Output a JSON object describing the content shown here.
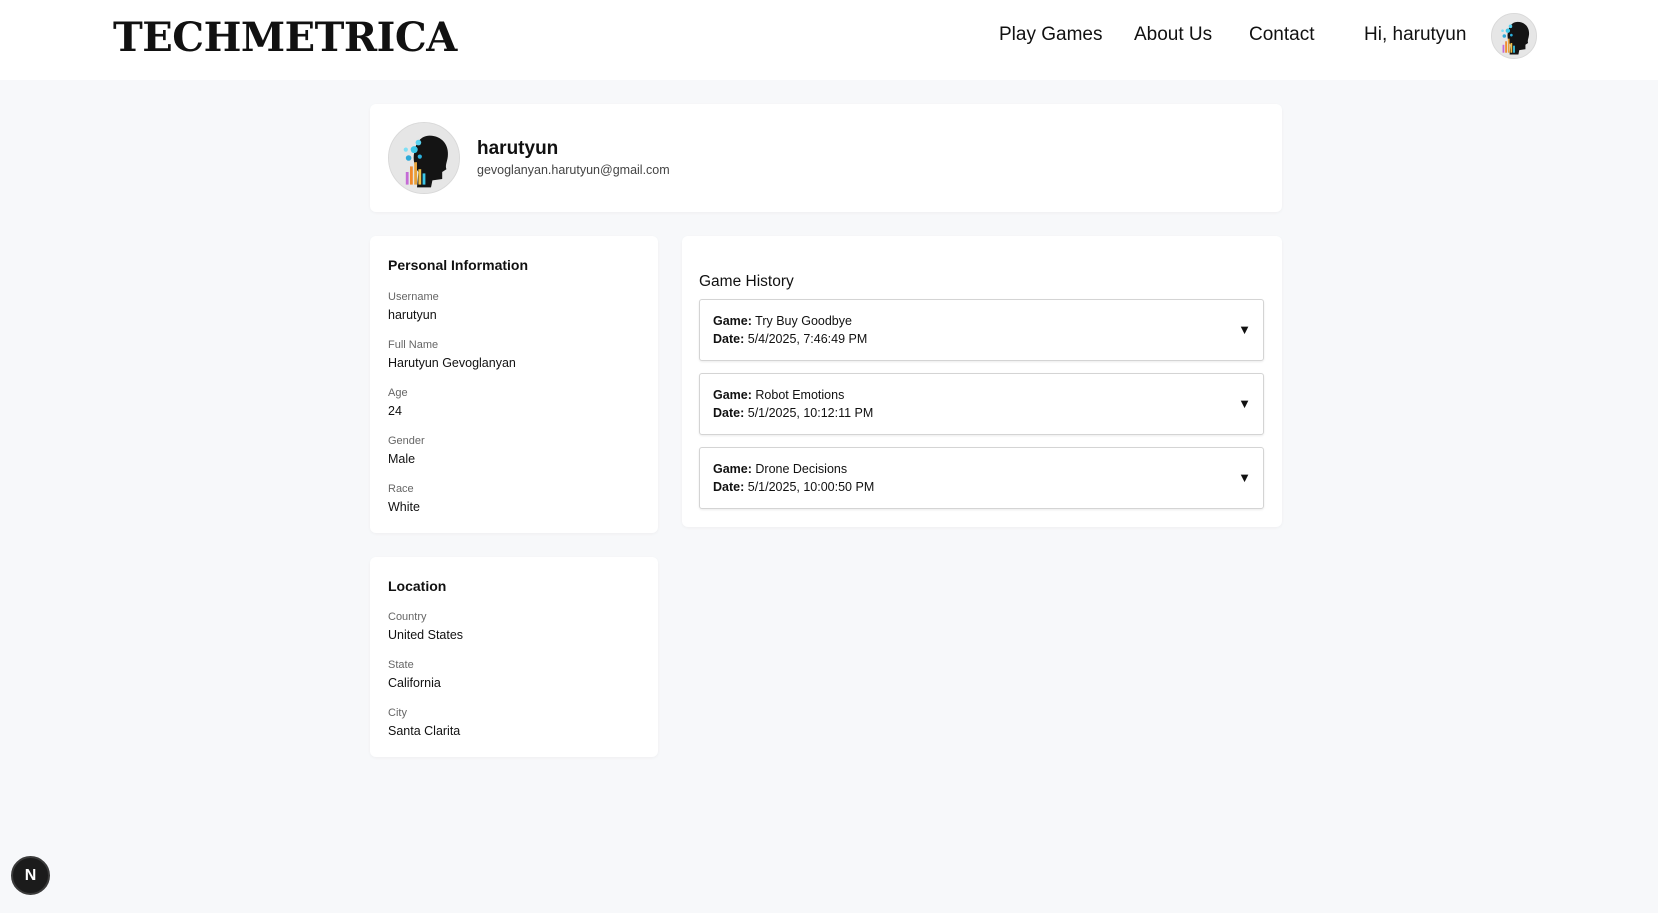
{
  "header": {
    "brand": "TECHMETRICA",
    "nav": [
      "Play Games",
      "About Us",
      "Contact"
    ],
    "greeting": "Hi, harutyun"
  },
  "profile": {
    "name": "harutyun",
    "email": "gevoglanyan.harutyun@gmail.com"
  },
  "personal": {
    "title": "Personal Information",
    "fields": [
      {
        "label": "Username",
        "value": "harutyun"
      },
      {
        "label": "Full Name",
        "value": "Harutyun Gevoglanyan"
      },
      {
        "label": "Age",
        "value": "24"
      },
      {
        "label": "Gender",
        "value": "Male"
      },
      {
        "label": "Race",
        "value": "White"
      }
    ]
  },
  "location": {
    "title": "Location",
    "fields": [
      {
        "label": "Country",
        "value": "United States"
      },
      {
        "label": "State",
        "value": "California"
      },
      {
        "label": "City",
        "value": "Santa Clarita"
      }
    ]
  },
  "game_history": {
    "title": "Game History",
    "game_label": "Game:",
    "date_label": "Date:",
    "items": [
      {
        "game": "Try Buy Goodbye",
        "date": "5/4/2025, 7:46:49 PM"
      },
      {
        "game": "Robot Emotions",
        "date": "5/1/2025, 10:12:11 PM"
      },
      {
        "game": "Drone Decisions",
        "date": "5/1/2025, 10:00:50 PM"
      }
    ],
    "expand_icon": "▼"
  },
  "dev_badge": {
    "label": "N"
  },
  "icons": {
    "avatar": "avatar-icon",
    "expand": "chevron-down-icon",
    "framework": "nextjs-icon"
  }
}
